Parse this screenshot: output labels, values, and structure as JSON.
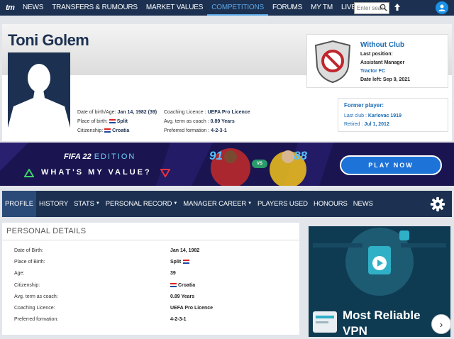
{
  "nav": {
    "logo": "tm",
    "items": [
      "NEWS",
      "TRANSFERS & RUMOURS",
      "MARKET VALUES",
      "COMPETITIONS",
      "FORUMS",
      "MY TM",
      "LIVE"
    ],
    "active_index": 3,
    "search_placeholder": "Enter sear"
  },
  "profile": {
    "name": "Toni Golem",
    "dob_label": "Date of birth/Age:",
    "dob": "Jan 14, 1982 (39)",
    "pob_label": "Place of birth:",
    "pob": "Split",
    "citizenship_label": "Citizenship:",
    "citizenship": "Croatia",
    "licence_label": "Coaching Licence :",
    "licence": "UEFA Pro Licence",
    "avg_label": "Avg. term as coach :",
    "avg": "0.89 Years",
    "formation_label": "Preferred formation :",
    "formation": "4-2-3-1"
  },
  "club": {
    "title": "Without Club",
    "last_position_label": "Last position:",
    "last_position": "Assistant Manager",
    "club": "Tractor FC",
    "date_left_label": "Date left:",
    "date_left": "Sep 9, 2021"
  },
  "former": {
    "title": "Former player:",
    "last_club_label": "Last club :",
    "last_club": "Karlovac 1919",
    "retired_label": "Retired :",
    "retired": "Jul 1, 2012"
  },
  "banner": {
    "fifa": "FIFA 22",
    "edition": "EDITION",
    "value_text": "WHAT'S MY VALUE?",
    "rating_left": "91",
    "rating_right": "88",
    "vs": "VS",
    "play": "PLAY NOW"
  },
  "subnav": {
    "items": [
      {
        "label": "PROFILE",
        "caret": false
      },
      {
        "label": "HISTORY",
        "caret": false
      },
      {
        "label": "STATS",
        "caret": true
      },
      {
        "label": "PERSONAL RECORD",
        "caret": true
      },
      {
        "label": "MANAGER CAREER",
        "caret": true
      },
      {
        "label": "PLAYERS USED",
        "caret": false
      },
      {
        "label": "HONOURS",
        "caret": false
      },
      {
        "label": "NEWS",
        "caret": false
      }
    ]
  },
  "details": {
    "title": "PERSONAL DETAILS",
    "rows": [
      {
        "label": "Date of Birth:",
        "value": "Jan 14, 1982",
        "flag": false
      },
      {
        "label": "Place of Birth:",
        "value": "Split",
        "flag": true,
        "flag_after": true
      },
      {
        "label": "Age:",
        "value": "39",
        "flag": false
      },
      {
        "label": "Citizenship:",
        "value": "Croatia",
        "flag": true,
        "flag_after": false
      },
      {
        "label": "Avg. term as coach:",
        "value": "0.89 Years",
        "flag": false
      },
      {
        "label": "Coaching Licence:",
        "value": "UEFA Pro Licence",
        "flag": false
      },
      {
        "label": "Preferred formation:",
        "value": "4-2-3-1",
        "flag": false
      }
    ]
  },
  "ad": {
    "text_line1": "Most Reliable",
    "text_line2": "VPN"
  },
  "colors": {
    "navy": "#1c3151",
    "link_blue": "#1a6bb5",
    "active_nav": "#5aa7e6",
    "play_button": "#1e73d8"
  }
}
